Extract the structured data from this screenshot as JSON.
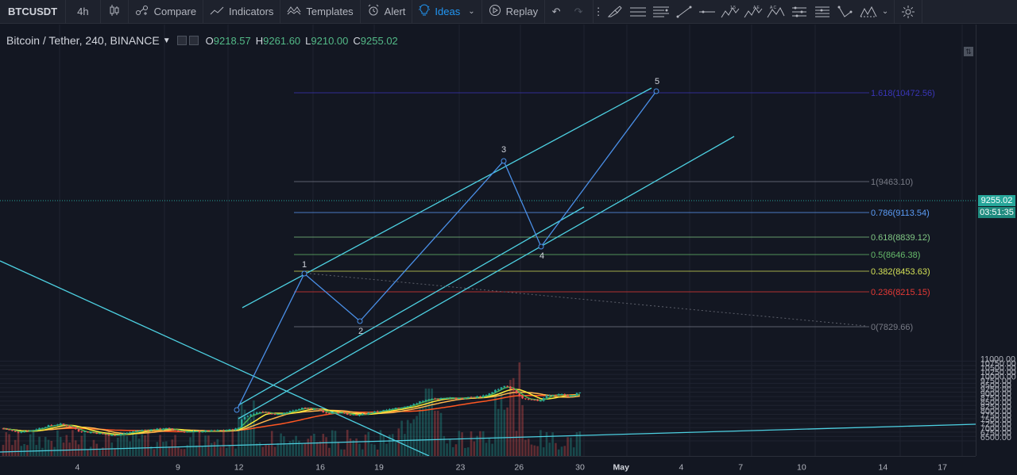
{
  "toolbar": {
    "symbol": "BTCUSDT",
    "interval": "4h",
    "compare_label": "Compare",
    "indicators_label": "Indicators",
    "templates_label": "Templates",
    "alert_label": "Alert",
    "ideas_label": "Ideas",
    "replay_label": "Replay",
    "active_color": "#2196f3"
  },
  "legend": {
    "title": "Bitcoin / Tether, 240, BINANCE",
    "open_key": "O",
    "open": "9218.57",
    "high_key": "H",
    "high": "9261.60",
    "low_key": "L",
    "low": "9210.00",
    "close_key": "C",
    "close": "9255.02"
  },
  "price_axis": {
    "ticks": [
      "11000.00",
      "10750.00",
      "10500.00",
      "10250.00",
      "10000.00",
      "9750.00",
      "9500.00",
      "9250.00",
      "9000.00",
      "8750.00",
      "8500.00",
      "8250.00",
      "8000.00",
      "7750.00",
      "7500.00",
      "7250.00",
      "7000.00",
      "6750.00",
      "6500.00"
    ],
    "last_price": "9255.02",
    "countdown": "03:51:35"
  },
  "time_axis": {
    "labels": [
      "4",
      "9",
      "12",
      "16",
      "19",
      "23",
      "26",
      "30",
      "May",
      "4",
      "7",
      "10",
      "14",
      "17"
    ]
  },
  "fib": {
    "levels": [
      {
        "label": "1.618(10472.56)",
        "color": "#3a36b8"
      },
      {
        "label": "1(9463.10)",
        "color": "#787b86"
      },
      {
        "label": "0.786(9113.54)",
        "color": "#5b9cf6"
      },
      {
        "label": "0.618(8839.12)",
        "color": "#81c784"
      },
      {
        "label": "0.5(8646.38)",
        "color": "#66bb6a"
      },
      {
        "label": "0.382(8453.63)",
        "color": "#d4e157"
      },
      {
        "label": "0.236(8215.15)",
        "color": "#e53935"
      },
      {
        "label": "0(7829.66)",
        "color": "#787b86"
      }
    ]
  },
  "waves": {
    "labels": [
      "1",
      "2",
      "3",
      "4",
      "5"
    ],
    "color": "#4a8fe7"
  },
  "colors": {
    "up": "#26a69a",
    "down": "#ef5350",
    "channel": "#4dd0e1",
    "ma_fast": "#4caf50",
    "ma_mid": "#ffeb3b",
    "ma_slow1": "#ffb74d",
    "ma_slow2": "#ff5722"
  }
}
